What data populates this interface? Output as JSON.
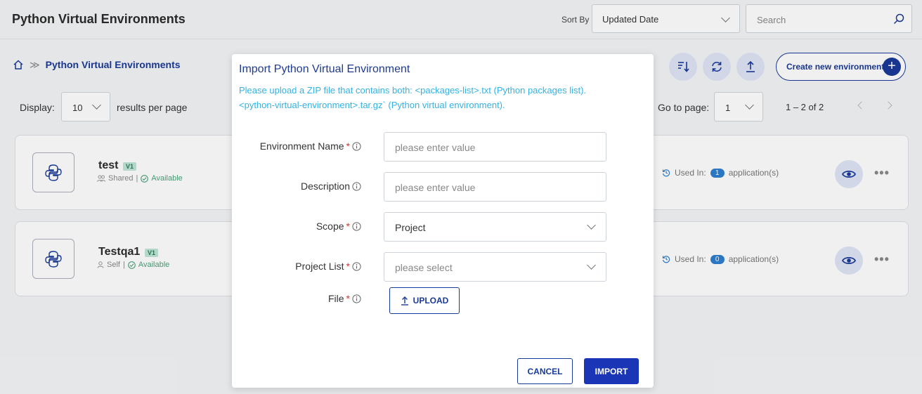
{
  "header": {
    "title": "Python Virtual Environments",
    "sort_by_label": "Sort By",
    "sort_value": "Updated Date",
    "search_placeholder": "Search"
  },
  "breadcrumb": {
    "current": "Python Virtual Environments"
  },
  "toolbar": {
    "create_label": "Create new environment"
  },
  "pagination": {
    "display_label": "Display:",
    "per_page_value": "10",
    "results_per_page_label": "results per page",
    "goto_label": "Go to page:",
    "page_value": "1",
    "range_text": "1 – 2 of 2"
  },
  "environments": [
    {
      "name": "test",
      "version": "V1",
      "scope": "Shared",
      "separator": "|",
      "status": "Available",
      "used_in_label": "Used In:",
      "used_count": "1",
      "used_suffix": "application(s)"
    },
    {
      "name": "Testqa1",
      "version": "V1",
      "scope": "Self",
      "separator": "|",
      "status": "Available",
      "used_in_label": "Used In:",
      "used_count": "0",
      "used_suffix": "application(s)"
    }
  ],
  "modal": {
    "title": "Import Python Virtual Environment",
    "description_line1": "Please upload a ZIP file that contains both: <packages-list>.txt (Python packages list).",
    "description_line2": "<python-virtual-environment>.tar.gz` (Python virtual environment).",
    "fields": {
      "env_name_label": "Environment Name",
      "env_name_placeholder": "please enter value",
      "description_label": "Description",
      "description_placeholder": "please enter value",
      "scope_label": "Scope",
      "scope_value": "Project",
      "project_list_label": "Project List",
      "project_list_placeholder": "please select",
      "file_label": "File",
      "required_mark": "*"
    },
    "upload_label": "UPLOAD",
    "cancel_label": "CANCEL",
    "import_label": "IMPORT"
  },
  "colors": {
    "primary": "#1a3a9a",
    "import_button": "#1a35b5",
    "hint_text": "#34b2e5",
    "required": "#e0312b",
    "available": "#4aa27a",
    "count_badge": "#2f7fd1"
  }
}
